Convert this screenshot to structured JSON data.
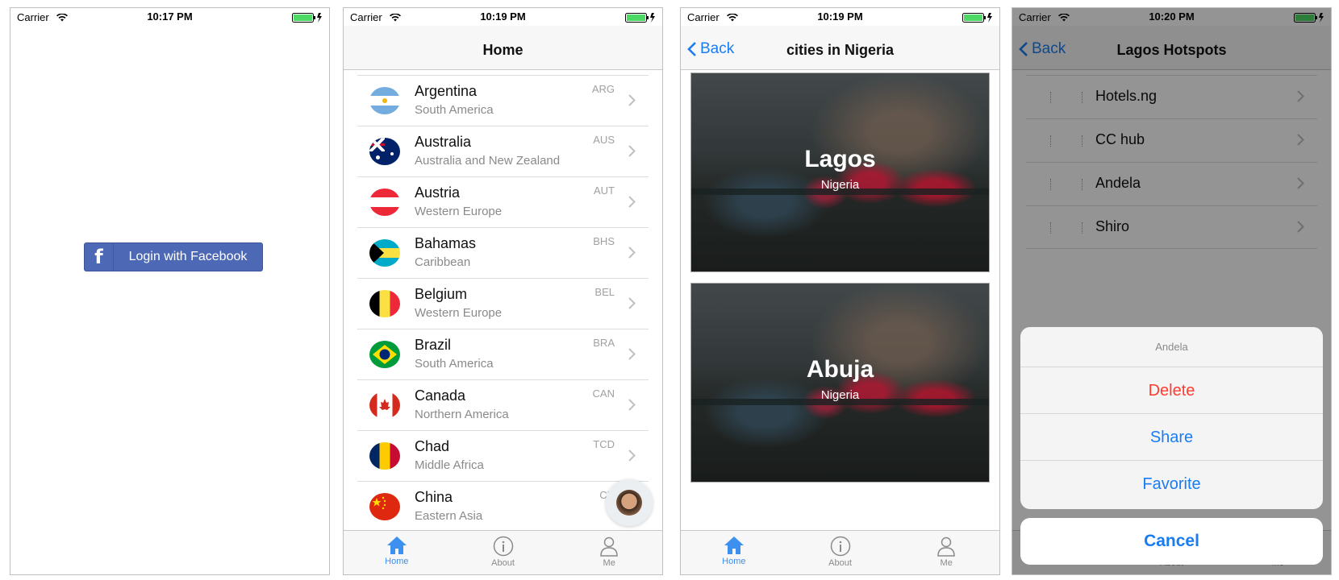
{
  "screens": {
    "login": {
      "status": {
        "carrier": "Carrier",
        "time": "10:17 PM"
      },
      "facebook_button": "Login with Facebook"
    },
    "home": {
      "status": {
        "carrier": "Carrier",
        "time": "10:19 PM"
      },
      "title": "Home",
      "countries": [
        {
          "name": "Argentina",
          "region": "South America",
          "code": "ARG"
        },
        {
          "name": "Australia",
          "region": "Australia and New Zealand",
          "code": "AUS"
        },
        {
          "name": "Austria",
          "region": "Western Europe",
          "code": "AUT"
        },
        {
          "name": "Bahamas",
          "region": "Caribbean",
          "code": "BHS"
        },
        {
          "name": "Belgium",
          "region": "Western Europe",
          "code": "BEL"
        },
        {
          "name": "Brazil",
          "region": "South America",
          "code": "BRA"
        },
        {
          "name": "Canada",
          "region": "Northern America",
          "code": "CAN"
        },
        {
          "name": "Chad",
          "region": "Middle Africa",
          "code": "TCD"
        },
        {
          "name": "China",
          "region": "Eastern Asia",
          "code": "CH"
        }
      ],
      "tabs": [
        {
          "label": "Home",
          "icon": "house-icon",
          "active": true
        },
        {
          "label": "About",
          "icon": "info-icon",
          "active": false
        },
        {
          "label": "Me",
          "icon": "person-icon",
          "active": false
        }
      ]
    },
    "cities": {
      "status": {
        "carrier": "Carrier",
        "time": "10:19 PM"
      },
      "back": "Back",
      "title": "cities in Nigeria",
      "cards": [
        {
          "city": "Lagos",
          "country": "Nigeria"
        },
        {
          "city": "Abuja",
          "country": "Nigeria"
        }
      ],
      "tabs": [
        {
          "label": "Home",
          "icon": "house-icon",
          "active": true
        },
        {
          "label": "About",
          "icon": "info-icon",
          "active": false
        },
        {
          "label": "Me",
          "icon": "person-icon",
          "active": false
        }
      ]
    },
    "hotspots": {
      "status": {
        "carrier": "Carrier",
        "time": "10:20 PM"
      },
      "back": "Back",
      "title": "Lagos Hotspots",
      "items": [
        "Hotels.ng",
        "CC hub",
        "Andela",
        "Shiro"
      ],
      "action_sheet": {
        "title": "Andela",
        "options": [
          "Delete",
          "Share",
          "Favorite"
        ],
        "cancel": "Cancel"
      },
      "tabs": [
        {
          "label": "Home"
        },
        {
          "label": "About"
        },
        {
          "label": "Me"
        }
      ]
    }
  },
  "colors": {
    "ios_blue": "#1a7cf2",
    "destructive_red": "#ff3b30",
    "facebook_blue": "#4d69b5",
    "tab_active": "#3d8ff0"
  }
}
